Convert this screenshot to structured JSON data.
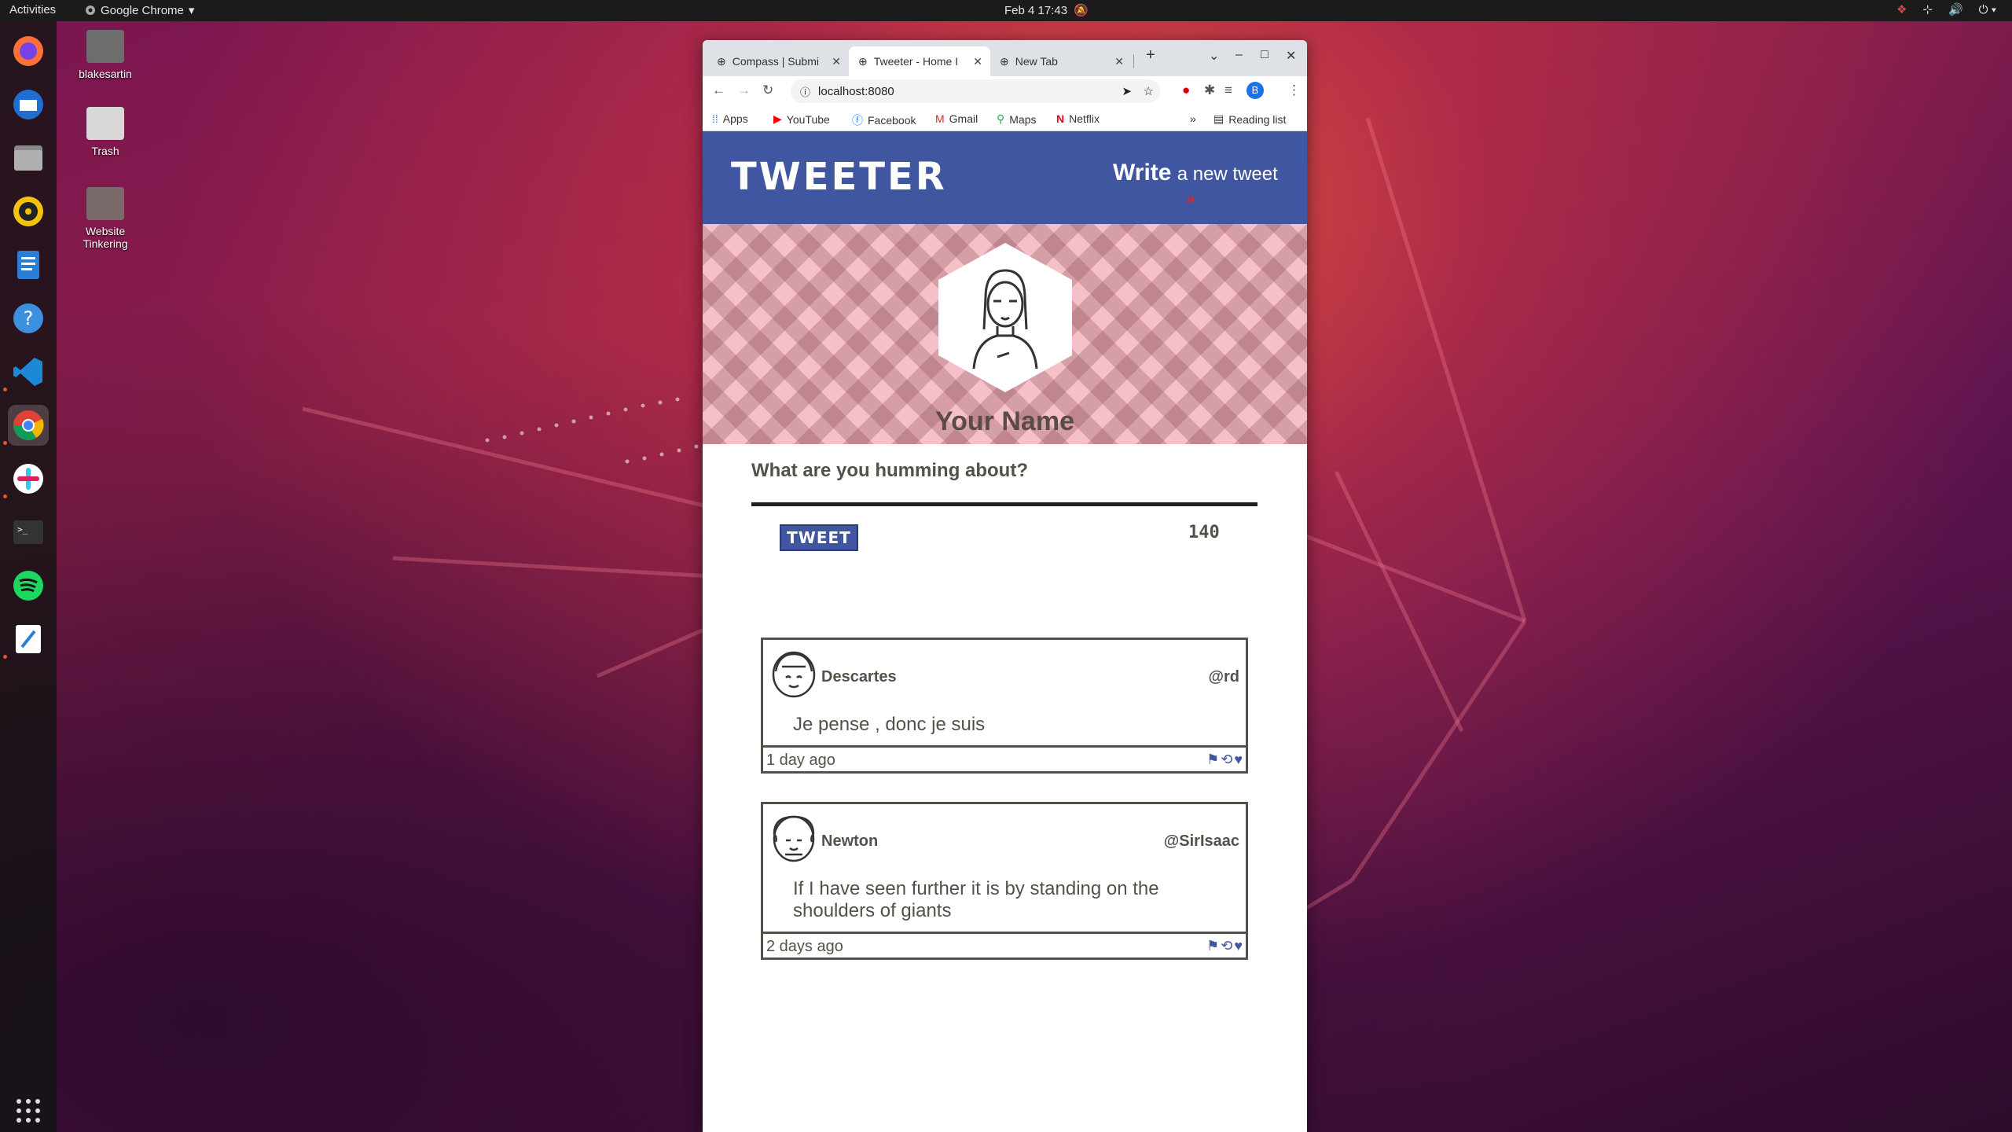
{
  "topbar": {
    "activities": "Activities",
    "app_name": "Google Chrome",
    "clock": "Feb 4  17:43"
  },
  "desktop": {
    "icons": [
      {
        "label": "blakesartin"
      },
      {
        "label": "Trash"
      },
      {
        "label": "Website Tinkering"
      }
    ]
  },
  "browser": {
    "tabs": [
      {
        "label": "Compass | Submi"
      },
      {
        "label": "Tweeter - Home I"
      },
      {
        "label": "New Tab"
      }
    ],
    "url": "localhost:8080",
    "bookmarks": [
      {
        "label": "Apps"
      },
      {
        "label": "YouTube"
      },
      {
        "label": "Facebook"
      },
      {
        "label": "Gmail"
      },
      {
        "label": "Maps"
      },
      {
        "label": "Netflix"
      }
    ],
    "reading_list": "Reading list",
    "overflow": "»"
  },
  "page": {
    "brand": "TWEETER",
    "write_bold": "Write",
    "write_rest": "a new tweet",
    "profile_name": "Your Name",
    "compose_prompt": "What are you humming about?",
    "tweet_button": "TWEET",
    "counter": "140",
    "tweets": [
      {
        "name": "Descartes",
        "handle": "@rd",
        "text": "Je pense , donc je suis",
        "time": "1 day ago"
      },
      {
        "name": "Newton",
        "handle": "@SirIsaac",
        "text": "If I have seen further it is by standing on the shoulders of giants",
        "time": "2 days ago"
      }
    ]
  },
  "colors": {
    "nav_bg": "#4056a1",
    "text": "#545149",
    "banner": "#f6c0c8"
  }
}
